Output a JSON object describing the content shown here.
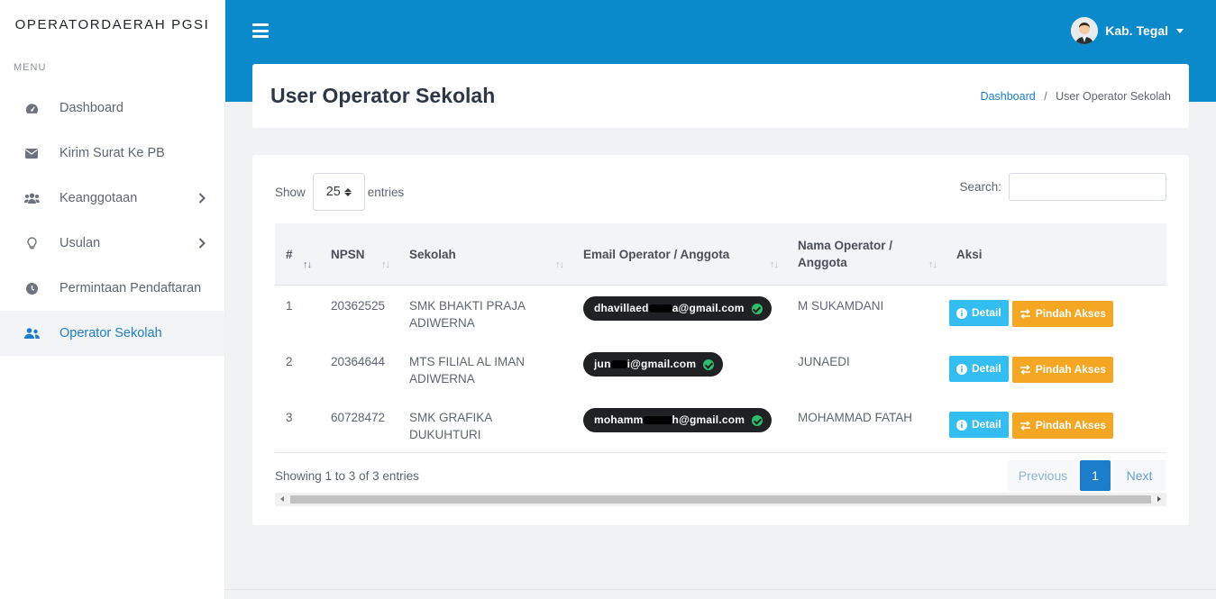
{
  "sidebar": {
    "brand": "OPERATORDAERAH PGSI",
    "menu_title": "MENU",
    "items": [
      {
        "label": "Dashboard",
        "icon": "gauge-icon"
      },
      {
        "label": "Kirim Surat Ke PB",
        "icon": "envelope-icon"
      },
      {
        "label": "Keanggotaan",
        "icon": "users-icon"
      },
      {
        "label": "Usulan",
        "icon": "lightbulb-icon"
      },
      {
        "label": "Permintaan Pendaftaran",
        "icon": "clock-icon"
      },
      {
        "label": "Operator Sekolah",
        "icon": "user-group-icon"
      }
    ]
  },
  "topbar": {
    "user_name": "Kab. Tegal"
  },
  "header": {
    "title": "User Operator Sekolah",
    "breadcrumb": [
      "Dashboard",
      "User Operator Sekolah"
    ]
  },
  "table_controls": {
    "show_label": "Show",
    "entries_value": "25",
    "entries_label": "entries",
    "search_label": "Search:"
  },
  "table": {
    "columns": [
      "#",
      "NPSN",
      "Sekolah",
      "Email Operator / Anggota",
      "Nama Operator / Anggota",
      "Aksi"
    ],
    "rows": [
      {
        "no": "1",
        "npsn": "20362525",
        "sekolah": "SMK BHAKTI PRAJA ADIWERNA",
        "email_pre": "dhavillaed",
        "email_post": "a@gmail.com",
        "nama": "M SUKAMDANI"
      },
      {
        "no": "2",
        "npsn": "20364644",
        "sekolah": "MTS FILIAL AL IMAN ADIWERNA",
        "email_pre": "jun",
        "email_post": "i@gmail.com",
        "nama": "JUNAEDI"
      },
      {
        "no": "3",
        "npsn": "60728472",
        "sekolah": "SMK GRAFIKA DUKUHTURI",
        "email_pre": "mohamm",
        "email_post": "h@gmail.com",
        "nama": "MOHAMMAD FATAH"
      }
    ],
    "detail_label": "Detail",
    "pindah_label": "Pindah Akses"
  },
  "footer": {
    "info": "Showing 1 to 3 of 3 entries",
    "previous": "Previous",
    "current_page": "1",
    "next": "Next"
  },
  "colors": {
    "primary": "#0a8acb",
    "info": "#33bdf0",
    "warning": "#f5a623",
    "active_link": "#1c7ecb"
  }
}
